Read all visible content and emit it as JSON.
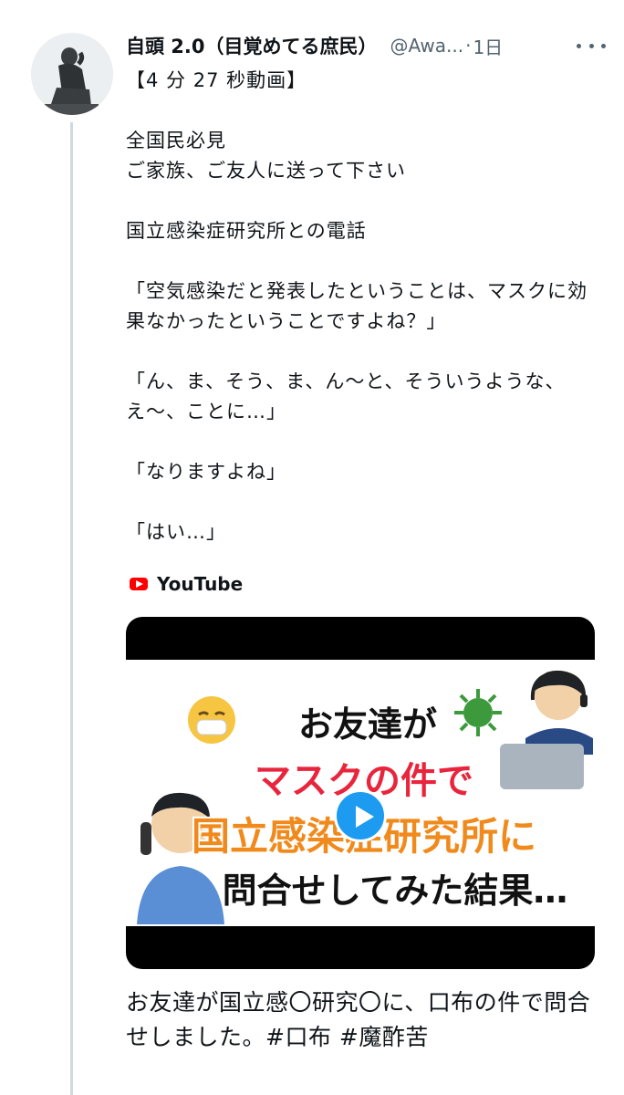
{
  "tweet": {
    "display_name": "自頭 2.0（目覚めてる庶民）",
    "handle": "@Awa...",
    "separator": "·",
    "time": "1日",
    "text": "【4 分 27 秒動画】\n\n全国民必見\nご家族、ご友人に送って下さい\n\n国立感染症研究所との電話\n\n「空気感染だと発表したということは、マスクに効果なかったということですよね？」\n\n「ん、ま、そう、ま、ん〜と、そういうような、え〜、ことに…」\n\n「なりますよね」\n\n「はい…」"
  },
  "card": {
    "source_label": "YouTube",
    "thumbnail_lines": [
      "お友達が",
      "マスクの件で",
      "国立感染症研究所に",
      "問合せしてみた結果…"
    ],
    "title": "お友達が国立感〇研究〇に、口布の件で問合せしました。#口布 #魔酢苦"
  },
  "colors": {
    "text": "#0f1419",
    "secondary": "#536471",
    "accent": "#1d9bf0",
    "thread_line": "#cfd9de",
    "youtube_red": "#ff0000",
    "thumbnail_red": "#e8253c",
    "thumbnail_orange": "#f08a1c"
  },
  "icons": [
    "thinker-statue-avatar",
    "more-icon",
    "youtube-icon",
    "play-icon",
    "sick-mask-emoji",
    "virus-icon",
    "phone-caller-icon",
    "headset-operator-icon"
  ]
}
